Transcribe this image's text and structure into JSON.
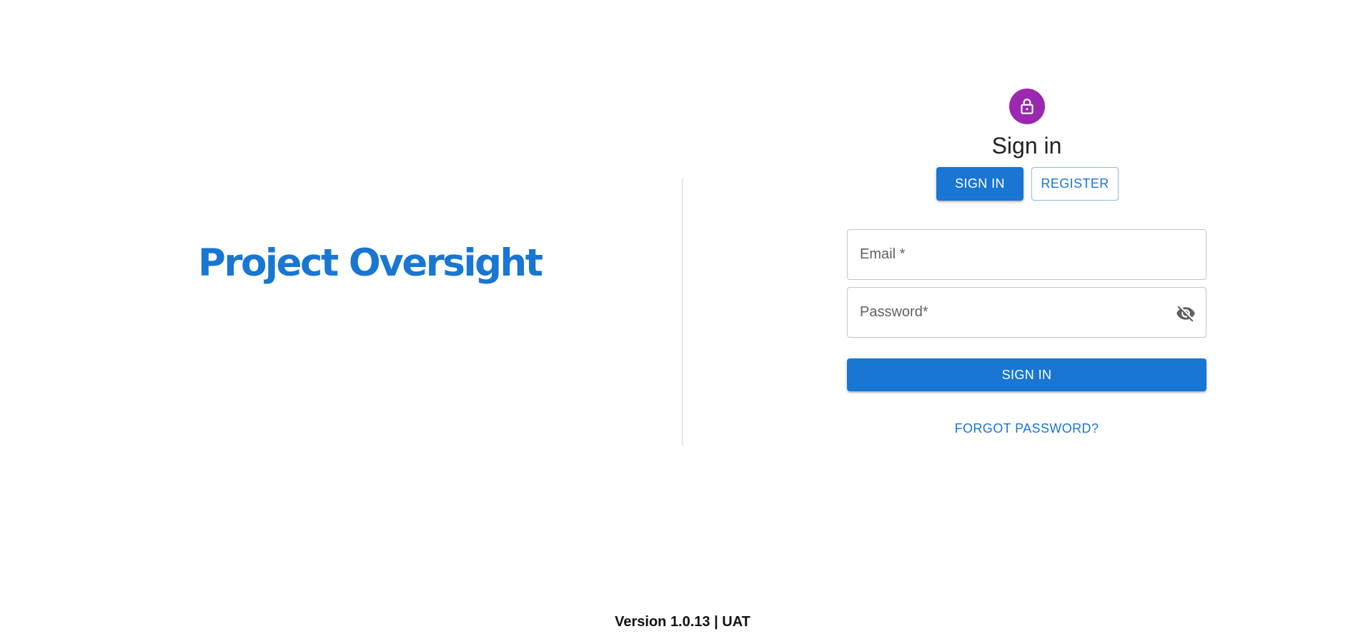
{
  "brand": {
    "logo_text": "Project Oversight"
  },
  "auth": {
    "title": "Sign in",
    "lock_icon": "lock-icon",
    "avatar_color": "#9c27b0",
    "tabs": {
      "sign_in_label": "SIGN IN",
      "register_label": "REGISTER",
      "active": "SIGN IN"
    },
    "email": {
      "placeholder": "Email *",
      "value": ""
    },
    "password": {
      "placeholder": "Password*",
      "value": "",
      "visibility_icon": "visibility-off-icon"
    },
    "submit_label": "SIGN IN",
    "forgot_label": "FORGOT PASSWORD?"
  },
  "footer": {
    "version_text": "Version 1.0.13 | UAT"
  },
  "colors": {
    "primary": "#1976d2",
    "accent": "#9c27b0",
    "divider": "#d6d6d6"
  }
}
